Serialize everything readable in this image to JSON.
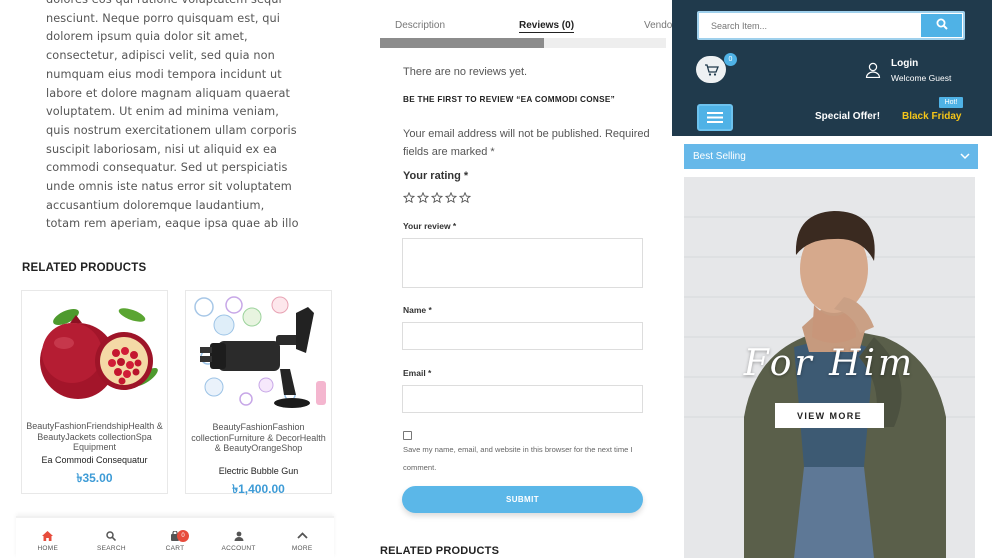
{
  "product_description": {
    "lines": [
      "dolores eos qui ratione voluptatem sequi",
      "nesciunt. Neque porro quisquam est, qui",
      "dolorem ipsum quia dolor sit amet,",
      "consectetur, adipisci velit, sed quia non",
      "numquam eius modi tempora incidunt ut",
      "labore et dolore magnam aliquam quaerat",
      "voluptatem. Ut enim ad minima veniam,",
      "quis nostrum exercitationem ullam corporis",
      "suscipit laboriosam, nisi ut aliquid ex ea",
      "commodi consequatur. Sed ut perspiciatis",
      "unde omnis iste natus error sit voluptatem",
      "accusantium doloremque laudantium,",
      "totam rem aperiam, eaque ipsa quae ab illo"
    ]
  },
  "related_products": {
    "title": "RELATED PRODUCTS",
    "items": [
      {
        "categories": "BeautyFashionFriendshipHealth & BeautyJackets collectionSpa Equipment",
        "name": "Ea Commodi Consequatur",
        "price": "৳35.00"
      },
      {
        "categories": "BeautyFashionFashion collectionFurniture & DecorHealth & BeautyOrangeShop",
        "name": "Electric Bubble Gun",
        "price": "৳1,400.00"
      }
    ]
  },
  "bottom_nav": {
    "items": [
      {
        "label": "HOME",
        "icon": "home-icon"
      },
      {
        "label": "SEARCH",
        "icon": "search-icon"
      },
      {
        "label": "CART",
        "icon": "cart-icon"
      },
      {
        "label": "ACCOUNT",
        "icon": "user-icon"
      },
      {
        "label": "MORE",
        "icon": "chevron-up-icon"
      }
    ],
    "cart_count": "0",
    "active_color": "#e74c3c"
  },
  "tabs": {
    "items": [
      "Description",
      "Reviews (0)",
      "Vendor"
    ],
    "active": "Reviews (0)"
  },
  "reviews": {
    "empty_text": "There are no reviews yet.",
    "first_to_review": "BE THE FIRST TO REVIEW “EA COMMODI CONSE”",
    "email_note": "Your email address will not be published. Required fields are marked *",
    "rating_label": "Your rating *",
    "review_label": "Your review *",
    "name_label": "Name *",
    "email_label": "Email *",
    "save_label": "Save my name, email, and website in this browser for the next time I comment.",
    "submit_label": "SUBMIT",
    "related_title": "RELATED PRODUCTS"
  },
  "header": {
    "search_placeholder": "Search Item...",
    "cart_count": "0",
    "login_label": "Login",
    "welcome_label": "Welcome Guest",
    "hot_label": "Hot!",
    "special_offer": "Special Offer!",
    "black_friday": "Black Friday",
    "colors": {
      "header_bg": "#203a4c",
      "accent": "#4fb2e6",
      "highlight": "#f5c518"
    }
  },
  "sidebar": {
    "best_selling_label": "Best Selling"
  },
  "banner": {
    "headline": "For Him",
    "cta_label": "VIEW MORE"
  }
}
